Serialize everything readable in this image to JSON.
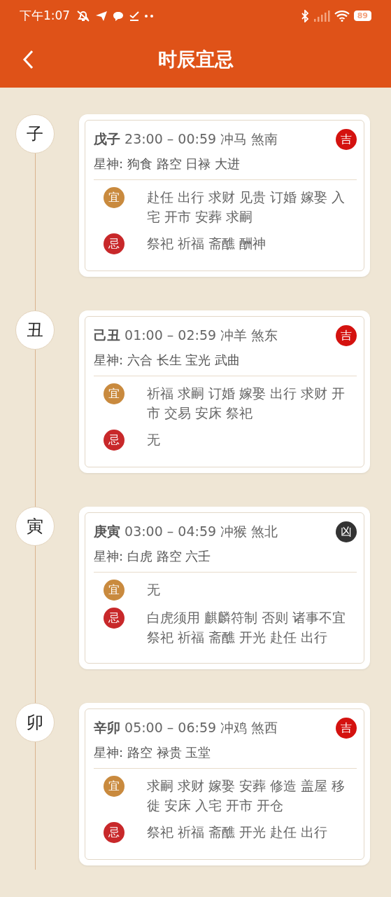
{
  "status_bar": {
    "time": "下午1:07",
    "battery": "89"
  },
  "header": {
    "title": "时辰宜忌"
  },
  "hours": [
    {
      "branch": "子",
      "name": "戊子",
      "time": "23:00 – 00:59 冲马 煞南",
      "verdict": {
        "label": "吉",
        "kind": "good"
      },
      "stars": "星神:  狗食 路空 日禄 大进",
      "rows": [
        {
          "kind": "yi",
          "label": "宜",
          "text": "赴任 出行 求财 见贵 订婚 嫁娶 入宅 开市 安葬 求嗣"
        },
        {
          "kind": "ji",
          "label": "忌",
          "text": "祭祀 祈福 斋醮 酬神"
        }
      ]
    },
    {
      "branch": "丑",
      "name": "己丑",
      "time": "01:00 – 02:59 冲羊 煞东",
      "verdict": {
        "label": "吉",
        "kind": "good"
      },
      "stars": "星神:  六合 长生 宝光 武曲",
      "rows": [
        {
          "kind": "yi",
          "label": "宜",
          "text": "祈福 求嗣 订婚 嫁娶 出行 求财 开市 交易 安床 祭祀"
        },
        {
          "kind": "ji",
          "label": "忌",
          "text": "无"
        }
      ]
    },
    {
      "branch": "寅",
      "name": "庚寅",
      "time": "03:00 – 04:59 冲猴 煞北",
      "verdict": {
        "label": "凶",
        "kind": "bad"
      },
      "stars": "星神:  白虎 路空 六壬",
      "rows": [
        {
          "kind": "yi",
          "label": "宜",
          "text": "无"
        },
        {
          "kind": "ji",
          "label": "忌",
          "text": "白虎须用 麒麟符制 否则 诸事不宜祭祀 祈福 斋醮 开光 赴任 出行"
        }
      ]
    },
    {
      "branch": "卯",
      "name": "辛卯",
      "time": "05:00 – 06:59 冲鸡 煞西",
      "verdict": {
        "label": "吉",
        "kind": "good"
      },
      "stars": "星神:  路空 禄贵 玉堂",
      "rows": [
        {
          "kind": "yi",
          "label": "宜",
          "text": "求嗣 求财 嫁娶 安葬 修造 盖屋 移徙 安床 入宅 开市 开仓"
        },
        {
          "kind": "ji",
          "label": "忌",
          "text": "祭祀 祈福 斋醮 开光 赴任 出行"
        }
      ]
    }
  ]
}
